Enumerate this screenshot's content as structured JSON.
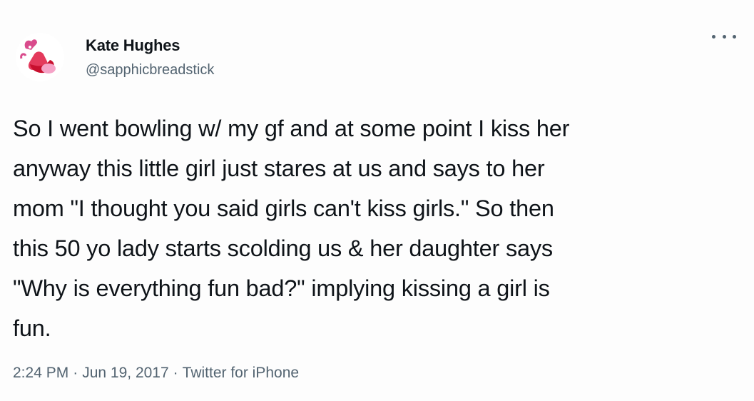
{
  "tweet": {
    "author": {
      "display_name": "Kate Hughes",
      "handle": "@sapphicbreadstick",
      "avatar_icon": "avatar-icon"
    },
    "more_icon": "more-horizontal-icon",
    "text": "So I went bowling w/ my gf and at some point I kiss her\nanyway this little girl just stares at us and says to her\nmom \"I thought you said girls can't kiss girls.\" So then\nthis 50 yo lady starts scolding us & her daughter says\n\"Why is everything fun bad?\" implying kissing a girl is\nfun.",
    "meta": {
      "time": "2:24 PM",
      "date": "Jun 19, 2017",
      "source": "Twitter for iPhone",
      "separator": "·"
    }
  },
  "colors": {
    "text_primary": "#0f1419",
    "text_secondary": "#536471",
    "background": "#fdfdfd"
  }
}
